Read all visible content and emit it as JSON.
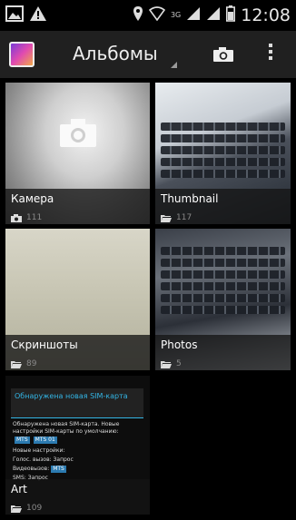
{
  "status_bar": {
    "time": "12:08",
    "network": "3G",
    "left_icons": [
      "image-icon",
      "warning-icon"
    ],
    "right_icons": [
      "location-icon",
      "wifi-icon",
      "signal-icon",
      "signal-icon",
      "battery-icon"
    ]
  },
  "action_bar": {
    "title": "Альбомы",
    "icons": [
      "gallery-app-icon",
      "camera-icon",
      "overflow-menu-icon"
    ]
  },
  "albums": [
    {
      "name": "Камера",
      "count": "111",
      "icon": "camera-icon"
    },
    {
      "name": "Thumbnail",
      "count": "117",
      "icon": "folder-icon"
    },
    {
      "name": "Скриншоты",
      "count": "89",
      "icon": "folder-icon"
    },
    {
      "name": "Photos",
      "count": "5",
      "icon": "folder-icon"
    },
    {
      "name": "Art",
      "count": "109",
      "icon": "folder-icon"
    }
  ],
  "art_thumbnail": {
    "header": "Обнаружена новая SIM-карта",
    "lines": [
      "Обнаружена новая SIM-карта. Новые",
      "настройки SIM-карты по умолчанию:",
      "MTS",
      "MTS 01",
      "Новые настройки:",
      "Голос. вызов: Запрос",
      "Видеовызов:",
      "SMS: Запрос"
    ]
  },
  "colors": {
    "accent": "#33b5e5",
    "actionbar": "#202020",
    "label_bg": "#141414"
  }
}
